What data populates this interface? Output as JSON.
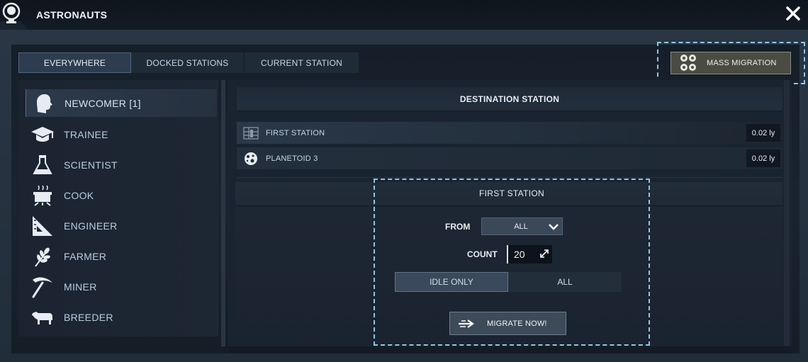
{
  "window": {
    "title": "ASTRONAUTS"
  },
  "tabs": [
    {
      "label": "EVERYWHERE",
      "active": true
    },
    {
      "label": "DOCKED STATIONS",
      "active": false
    },
    {
      "label": "CURRENT STATION",
      "active": false
    }
  ],
  "mass_migration": {
    "label": "MASS MIGRATION",
    "icon": "astronaut-group-icon"
  },
  "professions": [
    {
      "label": "NEWCOMER [1]",
      "icon": "head-icon",
      "active": true
    },
    {
      "label": "TRAINEE",
      "icon": "graduation-cap-icon"
    },
    {
      "label": "SCIENTIST",
      "icon": "flask-icon"
    },
    {
      "label": "COOK",
      "icon": "cooking-pot-icon"
    },
    {
      "label": "ENGINEER",
      "icon": "set-square-icon"
    },
    {
      "label": "FARMER",
      "icon": "wheat-icon"
    },
    {
      "label": "MINER",
      "icon": "pickaxe-icon"
    },
    {
      "label": "BREEDER",
      "icon": "cow-icon"
    }
  ],
  "destination": {
    "header": "DESTINATION STATION",
    "rows": [
      {
        "name": "FIRST STATION",
        "distance": "0.02 ly",
        "icon": "station-icon"
      },
      {
        "name": "PLANETOID 3",
        "distance": "0.02 ly",
        "icon": "planetoid-icon"
      }
    ]
  },
  "migration_panel": {
    "title": "FIRST STATION",
    "from_label": "FROM",
    "from_value": "ALL",
    "count_label": "COUNT",
    "count_value": "20",
    "toggle_idle": "IDLE ONLY",
    "toggle_all": "ALL",
    "migrate_label": "MIGRATE NOW!"
  },
  "colors": {
    "accent_dash": "#8cc8e4",
    "mass_migration_bg": "#4a4c44",
    "list_text": "#b7cde0"
  }
}
